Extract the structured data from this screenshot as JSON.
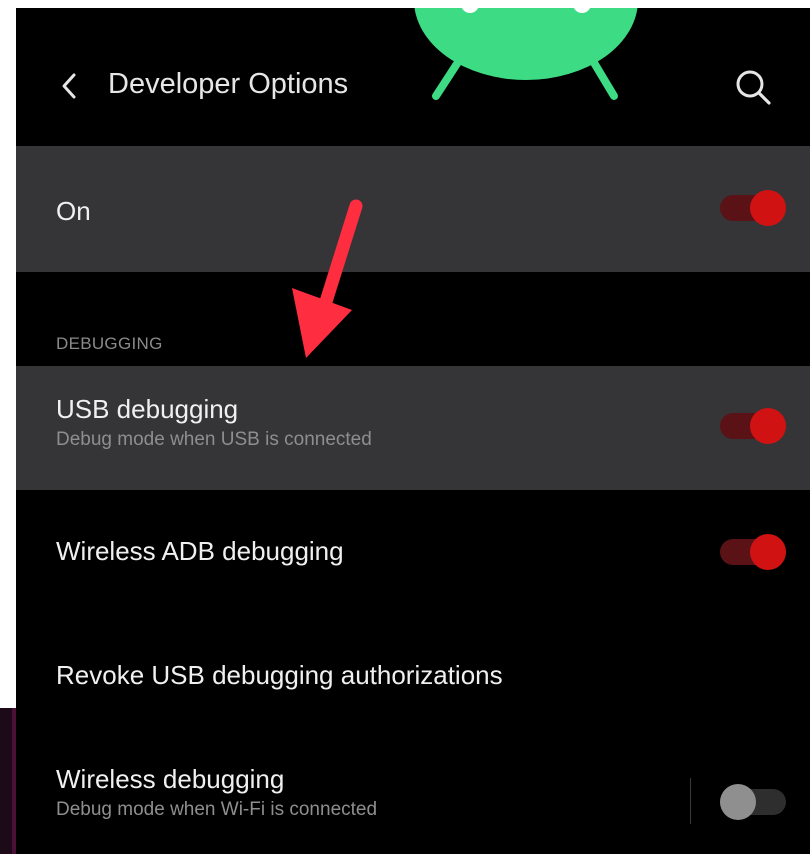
{
  "header": {
    "title": "Developer Options",
    "back_icon": "chevron-left-icon",
    "search_icon": "search-icon"
  },
  "master_switch": {
    "label": "On",
    "enabled": true
  },
  "section": {
    "label": "DEBUGGING"
  },
  "items": [
    {
      "title": "USB debugging",
      "subtitle": "Debug mode when USB is connected",
      "toggle": "on"
    },
    {
      "title": "Wireless ADB debugging",
      "toggle": "on"
    },
    {
      "title": "Revoke USB debugging authorizations"
    },
    {
      "title": "Wireless debugging",
      "subtitle": "Debug mode when Wi-Fi is connected",
      "toggle": "off"
    }
  ],
  "colors": {
    "background": "#000000",
    "highlight_row": "#353538",
    "toggle_on": "#d11212",
    "android_green": "#3ddc84",
    "annotation_arrow": "#ff2d40"
  }
}
